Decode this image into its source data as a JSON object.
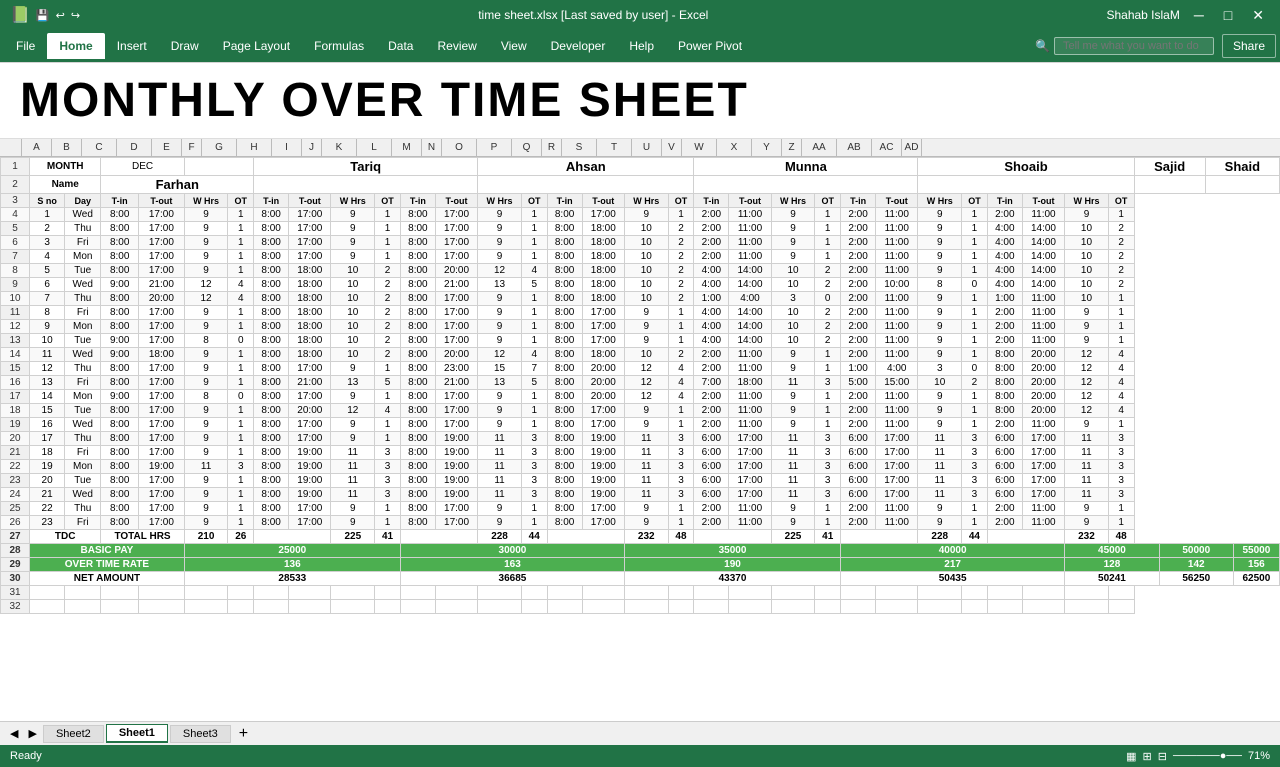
{
  "titleBar": {
    "title": "time sheet.xlsx [Last saved by user] - Excel",
    "user": "Shahab IslaM",
    "minimize": "─",
    "restore": "□",
    "close": "✕"
  },
  "ribbon": {
    "tabs": [
      "File",
      "Home",
      "Insert",
      "Draw",
      "Page Layout",
      "Formulas",
      "Data",
      "Review",
      "View",
      "Developer",
      "Help",
      "Power Pivot"
    ],
    "activeTab": "Home",
    "searchPlaceholder": "Tell me what you want to do",
    "share": "Share"
  },
  "sheet": {
    "bigTitle": "MONTHLY OVER TIME SHEET",
    "month": "DEC",
    "persons": [
      "Farhan",
      "Tariq",
      "Ahsan",
      "Munna",
      "Shoaib",
      "Sajid",
      "Shaid"
    ],
    "colHeaders": [
      "A",
      "B",
      "C",
      "D",
      "E",
      "F",
      "G",
      "H",
      "I",
      "J",
      "K",
      "L",
      "M",
      "N",
      "O",
      "P",
      "Q",
      "R",
      "S",
      "T",
      "U",
      "V",
      "W",
      "X",
      "Y",
      "Z",
      "AA",
      "AB",
      "AC",
      "AD"
    ],
    "dataRows": [
      [
        1,
        "Wed",
        "8:00",
        "17:00",
        9,
        1,
        "8:00",
        "17:00",
        9,
        1,
        "8:00",
        "17:00",
        9,
        1,
        "8:00",
        "17:00",
        9,
        1,
        "2:00",
        "11:00",
        9,
        1,
        "2:00",
        "11:00",
        9,
        1,
        "2:00",
        "11:00",
        9,
        1
      ],
      [
        2,
        "Thu",
        "8:00",
        "17:00",
        9,
        1,
        "8:00",
        "17:00",
        9,
        1,
        "8:00",
        "17:00",
        9,
        1,
        "8:00",
        "18:00",
        10,
        2,
        "2:00",
        "11:00",
        9,
        1,
        "2:00",
        "11:00",
        9,
        1,
        "4:00",
        "14:00",
        10,
        2
      ],
      [
        3,
        "Fri",
        "8:00",
        "17:00",
        9,
        1,
        "8:00",
        "17:00",
        9,
        1,
        "8:00",
        "17:00",
        9,
        1,
        "8:00",
        "18:00",
        10,
        2,
        "2:00",
        "11:00",
        9,
        1,
        "2:00",
        "11:00",
        9,
        1,
        "4:00",
        "14:00",
        10,
        2
      ],
      [
        4,
        "Mon",
        "8:00",
        "17:00",
        9,
        1,
        "8:00",
        "17:00",
        9,
        1,
        "8:00",
        "17:00",
        9,
        1,
        "8:00",
        "18:00",
        10,
        2,
        "2:00",
        "11:00",
        9,
        1,
        "2:00",
        "11:00",
        9,
        1,
        "4:00",
        "14:00",
        10,
        2
      ],
      [
        5,
        "Tue",
        "8:00",
        "17:00",
        9,
        1,
        "8:00",
        "18:00",
        10,
        2,
        "8:00",
        "20:00",
        12,
        4,
        "8:00",
        "18:00",
        10,
        2,
        "4:00",
        "14:00",
        10,
        2,
        "2:00",
        "11:00",
        9,
        1,
        "4:00",
        "14:00",
        10,
        2
      ],
      [
        6,
        "Wed",
        "9:00",
        "21:00",
        12,
        4,
        "8:00",
        "18:00",
        10,
        2,
        "8:00",
        "21:00",
        13,
        5,
        "8:00",
        "18:00",
        10,
        2,
        "4:00",
        "14:00",
        10,
        2,
        "2:00",
        "10:00",
        8,
        0,
        "4:00",
        "14:00",
        10,
        2
      ],
      [
        7,
        "Thu",
        "8:00",
        "20:00",
        12,
        4,
        "8:00",
        "18:00",
        10,
        2,
        "8:00",
        "17:00",
        9,
        1,
        "8:00",
        "18:00",
        10,
        2,
        "1:00",
        "4:00",
        3,
        0,
        "2:00",
        "11:00",
        9,
        1,
        "1:00",
        "11:00",
        10,
        1
      ],
      [
        8,
        "Fri",
        "8:00",
        "17:00",
        9,
        1,
        "8:00",
        "18:00",
        10,
        2,
        "8:00",
        "17:00",
        9,
        1,
        "8:00",
        "17:00",
        9,
        1,
        "4:00",
        "14:00",
        10,
        2,
        "2:00",
        "11:00",
        9,
        1,
        "2:00",
        "11:00",
        9,
        1
      ],
      [
        9,
        "Mon",
        "8:00",
        "17:00",
        9,
        1,
        "8:00",
        "18:00",
        10,
        2,
        "8:00",
        "17:00",
        9,
        1,
        "8:00",
        "17:00",
        9,
        1,
        "4:00",
        "14:00",
        10,
        2,
        "2:00",
        "11:00",
        9,
        1,
        "2:00",
        "11:00",
        9,
        1
      ],
      [
        10,
        "Tue",
        "9:00",
        "17:00",
        8,
        0,
        "8:00",
        "18:00",
        10,
        2,
        "8:00",
        "17:00",
        9,
        1,
        "8:00",
        "17:00",
        9,
        1,
        "4:00",
        "14:00",
        10,
        2,
        "2:00",
        "11:00",
        9,
        1,
        "2:00",
        "11:00",
        9,
        1
      ],
      [
        11,
        "Wed",
        "9:00",
        "18:00",
        9,
        1,
        "8:00",
        "18:00",
        10,
        2,
        "8:00",
        "20:00",
        12,
        4,
        "8:00",
        "18:00",
        10,
        2,
        "2:00",
        "11:00",
        9,
        1,
        "2:00",
        "11:00",
        9,
        1,
        "8:00",
        "20:00",
        12,
        4
      ],
      [
        12,
        "Thu",
        "8:00",
        "17:00",
        9,
        1,
        "8:00",
        "17:00",
        9,
        1,
        "8:00",
        "23:00",
        15,
        7,
        "8:00",
        "20:00",
        12,
        4,
        "2:00",
        "11:00",
        9,
        1,
        "1:00",
        "4:00",
        3,
        0,
        "8:00",
        "20:00",
        12,
        4
      ],
      [
        13,
        "Fri",
        "8:00",
        "17:00",
        9,
        1,
        "8:00",
        "21:00",
        13,
        5,
        "8:00",
        "21:00",
        13,
        5,
        "8:00",
        "20:00",
        12,
        4,
        "7:00",
        "18:00",
        11,
        3,
        "5:00",
        "15:00",
        10,
        2,
        "8:00",
        "20:00",
        12,
        4
      ],
      [
        14,
        "Mon",
        "9:00",
        "17:00",
        8,
        0,
        "8:00",
        "17:00",
        9,
        1,
        "8:00",
        "17:00",
        9,
        1,
        "8:00",
        "20:00",
        12,
        4,
        "2:00",
        "11:00",
        9,
        1,
        "2:00",
        "11:00",
        9,
        1,
        "8:00",
        "20:00",
        12,
        4
      ],
      [
        15,
        "Tue",
        "8:00",
        "17:00",
        9,
        1,
        "8:00",
        "20:00",
        12,
        4,
        "8:00",
        "17:00",
        9,
        1,
        "8:00",
        "17:00",
        9,
        1,
        "2:00",
        "11:00",
        9,
        1,
        "2:00",
        "11:00",
        9,
        1,
        "8:00",
        "20:00",
        12,
        4
      ],
      [
        16,
        "Wed",
        "8:00",
        "17:00",
        9,
        1,
        "8:00",
        "17:00",
        9,
        1,
        "8:00",
        "17:00",
        9,
        1,
        "8:00",
        "17:00",
        9,
        1,
        "2:00",
        "11:00",
        9,
        1,
        "2:00",
        "11:00",
        9,
        1,
        "2:00",
        "11:00",
        9,
        1
      ],
      [
        17,
        "Thu",
        "8:00",
        "17:00",
        9,
        1,
        "8:00",
        "17:00",
        9,
        1,
        "8:00",
        "19:00",
        11,
        3,
        "8:00",
        "19:00",
        11,
        3,
        "6:00",
        "17:00",
        11,
        3,
        "6:00",
        "17:00",
        11,
        3,
        "6:00",
        "17:00",
        11,
        3
      ],
      [
        18,
        "Fri",
        "8:00",
        "17:00",
        9,
        1,
        "8:00",
        "19:00",
        11,
        3,
        "8:00",
        "19:00",
        11,
        3,
        "8:00",
        "19:00",
        11,
        3,
        "6:00",
        "17:00",
        11,
        3,
        "6:00",
        "17:00",
        11,
        3,
        "6:00",
        "17:00",
        11,
        3
      ],
      [
        19,
        "Mon",
        "8:00",
        "19:00",
        11,
        3,
        "8:00",
        "19:00",
        11,
        3,
        "8:00",
        "19:00",
        11,
        3,
        "8:00",
        "19:00",
        11,
        3,
        "6:00",
        "17:00",
        11,
        3,
        "6:00",
        "17:00",
        11,
        3,
        "6:00",
        "17:00",
        11,
        3
      ],
      [
        20,
        "Tue",
        "8:00",
        "17:00",
        9,
        1,
        "8:00",
        "19:00",
        11,
        3,
        "8:00",
        "19:00",
        11,
        3,
        "8:00",
        "19:00",
        11,
        3,
        "6:00",
        "17:00",
        11,
        3,
        "6:00",
        "17:00",
        11,
        3,
        "6:00",
        "17:00",
        11,
        3
      ],
      [
        21,
        "Wed",
        "8:00",
        "17:00",
        9,
        1,
        "8:00",
        "19:00",
        11,
        3,
        "8:00",
        "19:00",
        11,
        3,
        "8:00",
        "19:00",
        11,
        3,
        "6:00",
        "17:00",
        11,
        3,
        "6:00",
        "17:00",
        11,
        3,
        "6:00",
        "17:00",
        11,
        3
      ],
      [
        22,
        "Thu",
        "8:00",
        "17:00",
        9,
        1,
        "8:00",
        "17:00",
        9,
        1,
        "8:00",
        "17:00",
        9,
        1,
        "8:00",
        "17:00",
        9,
        1,
        "2:00",
        "11:00",
        9,
        1,
        "2:00",
        "11:00",
        9,
        1,
        "2:00",
        "11:00",
        9,
        1
      ],
      [
        23,
        "Fri",
        "8:00",
        "17:00",
        9,
        1,
        "8:00",
        "17:00",
        9,
        1,
        "8:00",
        "17:00",
        9,
        1,
        "8:00",
        "17:00",
        9,
        1,
        "2:00",
        "11:00",
        9,
        1,
        "2:00",
        "11:00",
        9,
        1,
        "2:00",
        "11:00",
        9,
        1
      ]
    ],
    "totals": {
      "label": "TDC",
      "totalHrs": "TOTAL HRS",
      "farhan": {
        "hrs": 210,
        "ot": 26
      },
      "tariq": {
        "hrs": 225,
        "ot": 41
      },
      "ahsan": {
        "hrs": 228,
        "ot": 44
      },
      "munna": {
        "hrs": 232,
        "ot": 48
      },
      "shoaib": {
        "hrs": 225,
        "ot": 41
      },
      "sajid": {
        "hrs": 228,
        "ot": 44
      },
      "shaid": {
        "hrs": 232,
        "ot": 48
      }
    },
    "basicPay": {
      "label": "BASIC PAY",
      "farhan": 25000,
      "tariq": 30000,
      "ahsan": 35000,
      "munna": 40000,
      "shoaib": 45000,
      "sajid": 50000,
      "shaid": 55000
    },
    "otRate": {
      "label": "OVER TIME RATE",
      "farhan": 136,
      "tariq": 163,
      "ahsan": 190,
      "munna": 217,
      "shoaib": 128,
      "sajid": 142,
      "shaid": 156
    },
    "netAmount": {
      "label": "NET AMOUNT",
      "farhan": 28533,
      "tariq": 36685,
      "ahsan": 43370,
      "munna": 50435,
      "shoaib": 50241,
      "sajid": 56250,
      "shaid": 62500
    }
  },
  "sheets": [
    "Sheet2",
    "Sheet1",
    "Sheet3"
  ],
  "activeSheet": "Sheet1",
  "status": {
    "ready": "Ready",
    "zoom": "71%"
  }
}
